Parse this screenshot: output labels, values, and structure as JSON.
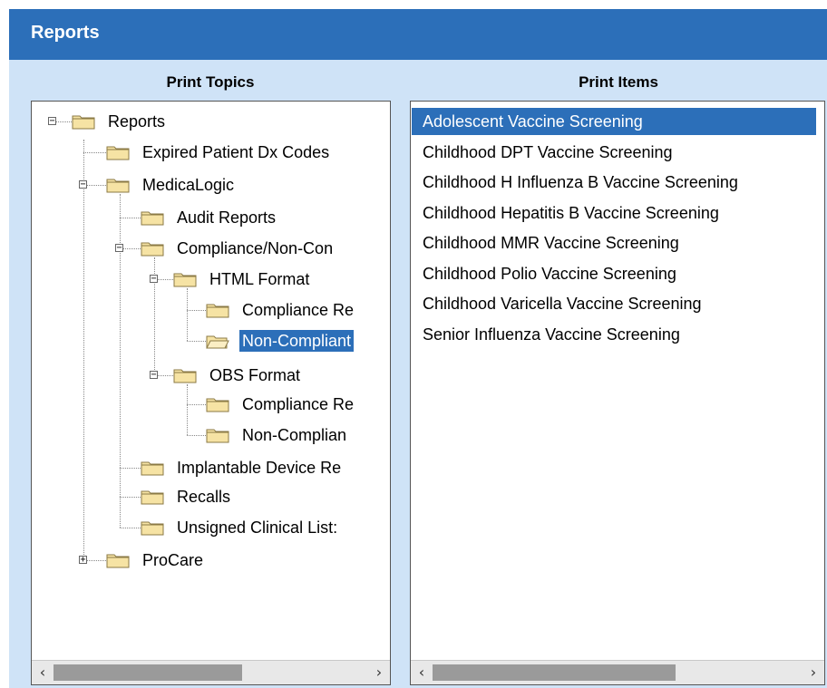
{
  "window": {
    "title": "Reports"
  },
  "left_pane": {
    "header": "Print Topics",
    "tree": [
      {
        "id": "reports",
        "label": "Reports",
        "expanded": true
      },
      {
        "id": "expired",
        "label": "Expired Patient Dx Codes"
      },
      {
        "id": "medicalogic",
        "label": "MedicaLogic",
        "expanded": true
      },
      {
        "id": "audit",
        "label": "Audit Reports"
      },
      {
        "id": "compliance",
        "label": "Compliance/Non-Con",
        "expanded": true
      },
      {
        "id": "html",
        "label": "HTML Format",
        "expanded": true
      },
      {
        "id": "html-compliance",
        "label": "Compliance Re"
      },
      {
        "id": "html-noncompliant",
        "label": "Non-Compliant",
        "selected": true,
        "open_folder": true
      },
      {
        "id": "obs",
        "label": "OBS Format",
        "expanded": true
      },
      {
        "id": "obs-compliance",
        "label": "Compliance Re"
      },
      {
        "id": "obs-noncompliant",
        "label": "Non-Complian"
      },
      {
        "id": "implantable",
        "label": "Implantable Device Re"
      },
      {
        "id": "recalls",
        "label": "Recalls"
      },
      {
        "id": "unsigned",
        "label": "Unsigned Clinical List:"
      },
      {
        "id": "procare",
        "label": "ProCare",
        "expanded": false
      }
    ]
  },
  "right_pane": {
    "header": "Print Items",
    "items": [
      "Adolescent Vaccine Screening",
      "Childhood DPT Vaccine Screening",
      "Childhood H Influenza B Vaccine Screening",
      "Childhood Hepatitis B Vaccine Screening",
      "Childhood MMR Vaccine Screening",
      "Childhood Polio Vaccine Screening",
      "Childhood Varicella Vaccine Screening",
      "Senior Influenza Vaccine Screening"
    ],
    "selected_index": 0
  },
  "icons": {
    "expander_expanded": "minus-box-icon",
    "expander_collapsed": "plus-box-icon",
    "folder": "folder-icon",
    "folder_open": "folder-open-icon",
    "scroll_left": "chevron-left-icon",
    "scroll_right": "chevron-right-icon"
  },
  "colors": {
    "titlebar": "#2c6fb9",
    "panel_background": "#cfe3f7",
    "selection": "#2c6fb9",
    "folder_fill": "#f6e3a4",
    "folder_stroke": "#8b7a45"
  }
}
